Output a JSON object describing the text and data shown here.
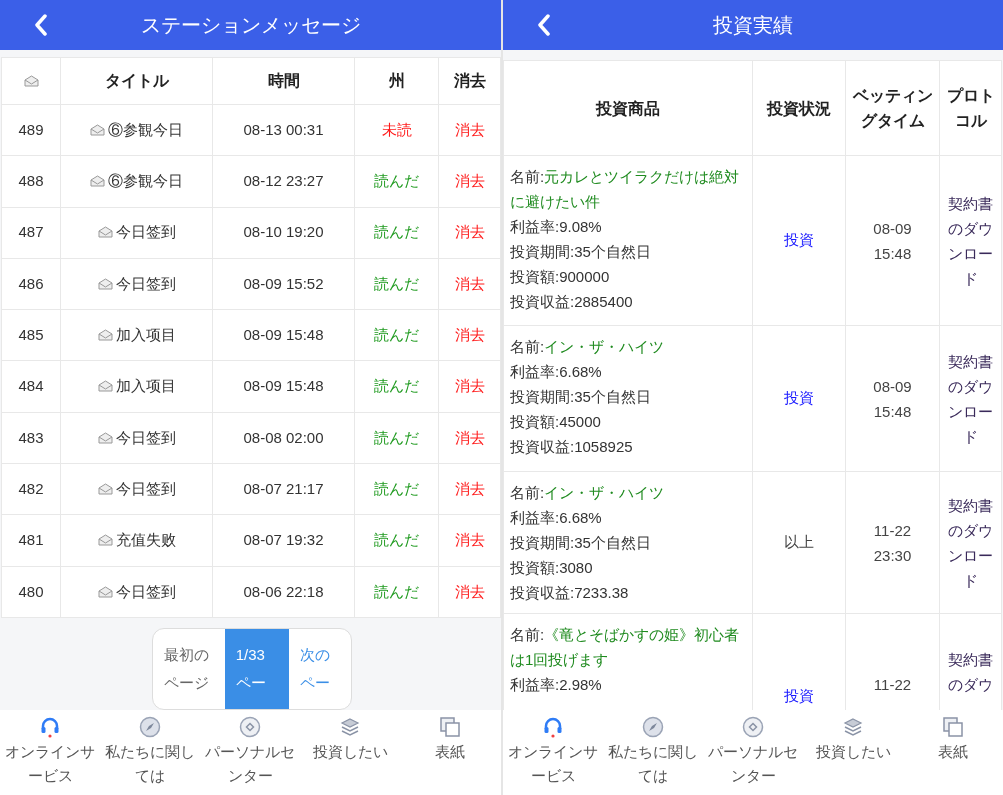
{
  "left": {
    "header": {
      "title": "ステーションメッセージ"
    },
    "table": {
      "columns": [
        "タイトル",
        "時間",
        "州",
        "消去"
      ],
      "rows": [
        {
          "id": "489",
          "title": "⑥参観今日",
          "time": "08-13 00:31",
          "status": "未読",
          "read": false,
          "action": "消去"
        },
        {
          "id": "488",
          "title": "⑥参観今日",
          "time": "08-12 23:27",
          "status": "読んだ",
          "read": true,
          "action": "消去"
        },
        {
          "id": "487",
          "title": "今日签到",
          "time": "08-10 19:20",
          "status": "読んだ",
          "read": true,
          "action": "消去"
        },
        {
          "id": "486",
          "title": "今日签到",
          "time": "08-09 15:52",
          "status": "読んだ",
          "read": true,
          "action": "消去"
        },
        {
          "id": "485",
          "title": "加入项目",
          "time": "08-09 15:48",
          "status": "読んだ",
          "read": true,
          "action": "消去"
        },
        {
          "id": "484",
          "title": "加入项目",
          "time": "08-09 15:48",
          "status": "読んだ",
          "read": true,
          "action": "消去"
        },
        {
          "id": "483",
          "title": "今日签到",
          "time": "08-08 02:00",
          "status": "読んだ",
          "read": true,
          "action": "消去"
        },
        {
          "id": "482",
          "title": "今日签到",
          "time": "08-07 21:17",
          "status": "読んだ",
          "read": true,
          "action": "消去"
        },
        {
          "id": "481",
          "title": "充值失败",
          "time": "08-07 19:32",
          "status": "読んだ",
          "read": true,
          "action": "消去"
        },
        {
          "id": "480",
          "title": "今日签到",
          "time": "08-06 22:18",
          "status": "読んだ",
          "read": true,
          "action": "消去"
        }
      ]
    },
    "pagination": [
      {
        "label": "最初のページ",
        "selected": false
      },
      {
        "label": "1/33ペー",
        "selected": true
      },
      {
        "label": "次のペー",
        "selected": false
      }
    ],
    "nav": [
      "オンラインサービス",
      "私たちに関しては",
      "パーソナルセンター",
      "投資したい",
      "表紙"
    ]
  },
  "right": {
    "header": {
      "title": "投資実績"
    },
    "table": {
      "columns": [
        "投資商品",
        "投資状況",
        "ベッティングタイム",
        "プロトコル"
      ],
      "rows": [
        {
          "details": [
            {
              "kind": "name",
              "label": "名前:",
              "value": "元カレとツイラクだけは絶対に避けたい件"
            },
            {
              "kind": "plain",
              "label": "利益率:",
              "value": "9.08%"
            },
            {
              "kind": "plain",
              "label": "投資期間:",
              "value": "35个自然日"
            },
            {
              "kind": "plain",
              "label": "投資額:",
              "value": "900000"
            },
            {
              "kind": "plain",
              "label": "投資収益:",
              "value": "2885400"
            }
          ],
          "status": "投資",
          "investing": true,
          "time": [
            "08-09",
            "15:48"
          ],
          "protocol": "契約書のダウンロード"
        },
        {
          "details": [
            {
              "kind": "name",
              "label": "名前:",
              "value": "イン・ザ・ハイツ"
            },
            {
              "kind": "plain",
              "label": "利益率:",
              "value": "6.68%"
            },
            {
              "kind": "plain",
              "label": "投資期間:",
              "value": "35个自然日"
            },
            {
              "kind": "plain",
              "label": "投資額:",
              "value": "45000"
            },
            {
              "kind": "plain",
              "label": "投資収益:",
              "value": "1058925"
            }
          ],
          "status": "投資",
          "investing": true,
          "time": [
            "08-09",
            "15:48"
          ],
          "protocol": "契約書のダウンロード"
        },
        {
          "details": [
            {
              "kind": "name",
              "label": "名前:",
              "value": "イン・ザ・ハイツ"
            },
            {
              "kind": "plain",
              "label": "利益率:",
              "value": "6.68%"
            },
            {
              "kind": "plain",
              "label": "投資期間:",
              "value": "35个自然日"
            },
            {
              "kind": "plain",
              "label": "投資額:",
              "value": "3080"
            },
            {
              "kind": "plain",
              "label": "投資収益:",
              "value": "7233.38"
            }
          ],
          "status": "以上",
          "investing": false,
          "time": [
            "11-22",
            "23:30"
          ],
          "protocol": "契約書のダウンロード"
        },
        {
          "details": [
            {
              "kind": "name",
              "label": "名前:",
              "value": "《竜とそばかすの姫》初心者は1回投げます"
            },
            {
              "kind": "plain",
              "label": "利益率:",
              "value": "2.98%"
            }
          ],
          "status": "投資",
          "investing": true,
          "time": [
            "11-22"
          ],
          "protocol": "契約書のダウ"
        }
      ]
    },
    "nav": [
      "オンラインサービス",
      "私たちに関しては",
      "パーソナルセンター",
      "投資したい",
      "表紙"
    ]
  }
}
